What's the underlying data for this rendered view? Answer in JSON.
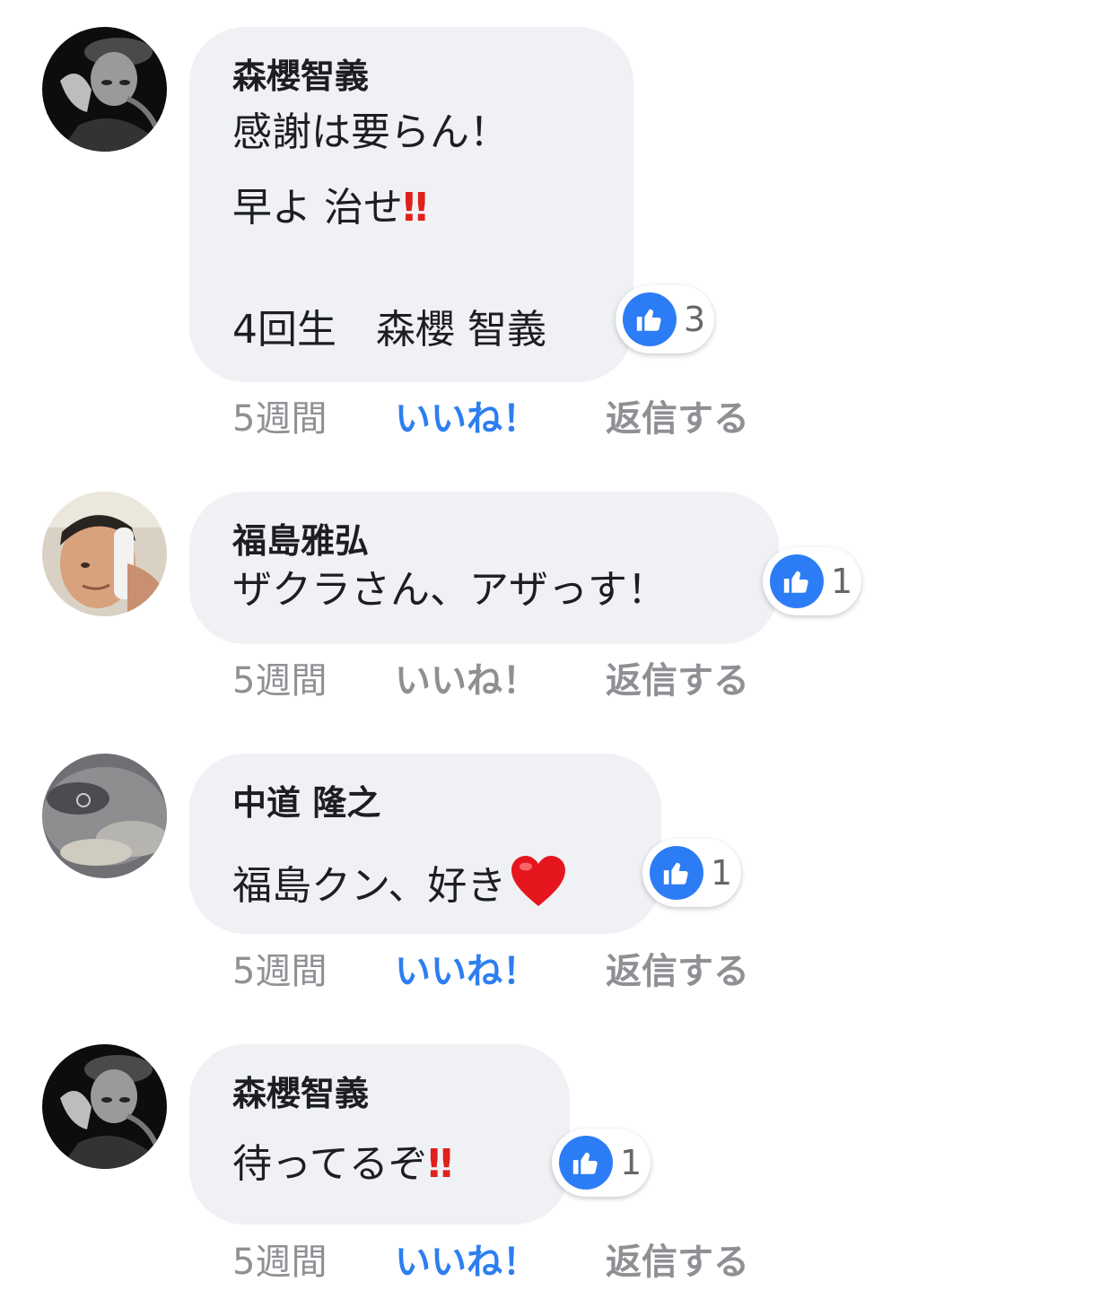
{
  "comments": [
    {
      "author": "森櫻智義",
      "lines": [
        "感謝は要らん！",
        "早よ 治せ",
        "4回生　森櫻 智義"
      ],
      "emphasis": "‼",
      "reaction": {
        "icon": "thumbs-up-icon",
        "count": "3"
      },
      "time": "5週間",
      "like_label": "いいね！",
      "reply_label": "返信する",
      "liked": true
    },
    {
      "author": "福島雅弘",
      "lines": [
        "ザクラさん、アザっす！"
      ],
      "reaction": {
        "icon": "thumbs-up-icon",
        "count": "1"
      },
      "time": "5週間",
      "like_label": "いいね！",
      "reply_label": "返信する",
      "liked": false
    },
    {
      "author": "中道 隆之",
      "lines": [
        "福島クン、好き"
      ],
      "emoji": "heart-icon",
      "reaction": {
        "icon": "thumbs-up-icon",
        "count": "1"
      },
      "time": "5週間",
      "like_label": "いいね！",
      "reply_label": "返信する",
      "liked": true
    },
    {
      "author": "森櫻智義",
      "lines": [
        "待ってるぞ"
      ],
      "emphasis": "‼",
      "reaction": {
        "icon": "thumbs-up-icon",
        "count": "1"
      },
      "time": "5週間",
      "like_label": "いいね！",
      "reply_label": "返信する",
      "liked": true
    }
  ],
  "colors": {
    "like_blue": "#2d7ef0",
    "bubble_bg": "#f0f1f4",
    "muted": "#8e9094",
    "emphasis_red": "#e0201b"
  }
}
